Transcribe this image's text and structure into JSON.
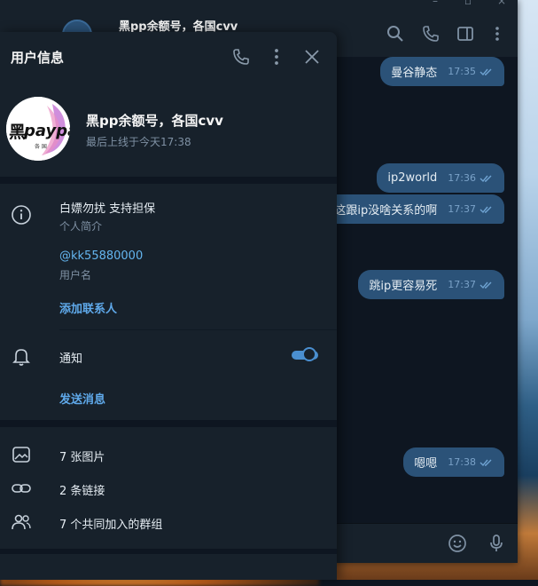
{
  "window": {
    "chat_title": "黑pp余额号，各国cvv"
  },
  "messages": [
    {
      "text": "曼谷静态",
      "time": "17:35"
    },
    {
      "text": "ip2world",
      "time": "17:36"
    },
    {
      "text": "这跟ip没啥关系的啊",
      "time": "17:37"
    },
    {
      "text": "跳ip更容易死",
      "time": "17:37"
    },
    {
      "text": "嗯嗯",
      "time": "17:38"
    }
  ],
  "panel": {
    "title": "用户信息",
    "profile": {
      "name": "黑pp余额号，各国cvv",
      "status": "最后上线于今天17:38",
      "avatar_text": "黑paypal",
      "avatar_subtext": "各 国"
    },
    "bio": {
      "value": "白嫖勿扰 支持担保",
      "label": "个人简介"
    },
    "username": {
      "value": "@kk55880000",
      "label": "用户名"
    },
    "add_contact": "添加联系人",
    "notifications": {
      "label": "通知",
      "enabled": true
    },
    "send_message": "发送消息",
    "media": [
      {
        "label": "7 张图片",
        "icon": "image-icon"
      },
      {
        "label": "2 条链接",
        "icon": "link-icon"
      },
      {
        "label": "7 个共同加入的群组",
        "icon": "groups-icon"
      }
    ]
  },
  "colors": {
    "panel_bg": "#17212b",
    "chat_bg": "#0e1621",
    "bubble_out": "#2b5278",
    "accent": "#5fa9ea"
  }
}
